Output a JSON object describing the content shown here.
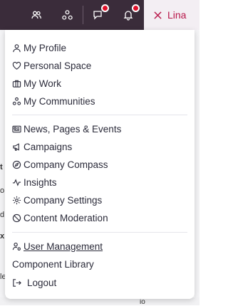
{
  "header": {
    "icons": [
      "people-icon",
      "communities-icon",
      "chat-icon",
      "bell-icon",
      "close-icon"
    ],
    "user_name": "Lina"
  },
  "menu": {
    "group1": [
      {
        "label": "My Profile",
        "icon": "user-icon"
      },
      {
        "label": "Personal Space",
        "icon": "heart-icon"
      },
      {
        "label": "My Work",
        "icon": "briefcase-icon"
      },
      {
        "label": "My Communities",
        "icon": "communities-icon"
      }
    ],
    "group2": [
      {
        "label": "News, Pages & Events",
        "icon": "newspaper-icon"
      },
      {
        "label": "Campaigns",
        "icon": "megaphone-icon"
      },
      {
        "label": "Company Compass",
        "icon": "compass-icon"
      },
      {
        "label": "Insights",
        "icon": "activity-icon"
      },
      {
        "label": "Company Settings",
        "icon": "gear-icon"
      },
      {
        "label": "Content Moderation",
        "icon": "ban-icon"
      }
    ],
    "group3": [
      {
        "label": "User Management",
        "icon": "user-cog-icon"
      },
      {
        "label": "Component Library",
        "icon": ""
      },
      {
        "label": "Logout",
        "icon": "logout-icon"
      }
    ]
  },
  "background": {
    "fragments": [
      "t",
      "o",
      "d",
      "x",
      "le",
      "io"
    ]
  },
  "colors": {
    "topbar": "#3a2c3a",
    "accent": "#b8174a",
    "badge": "#e0102a"
  }
}
